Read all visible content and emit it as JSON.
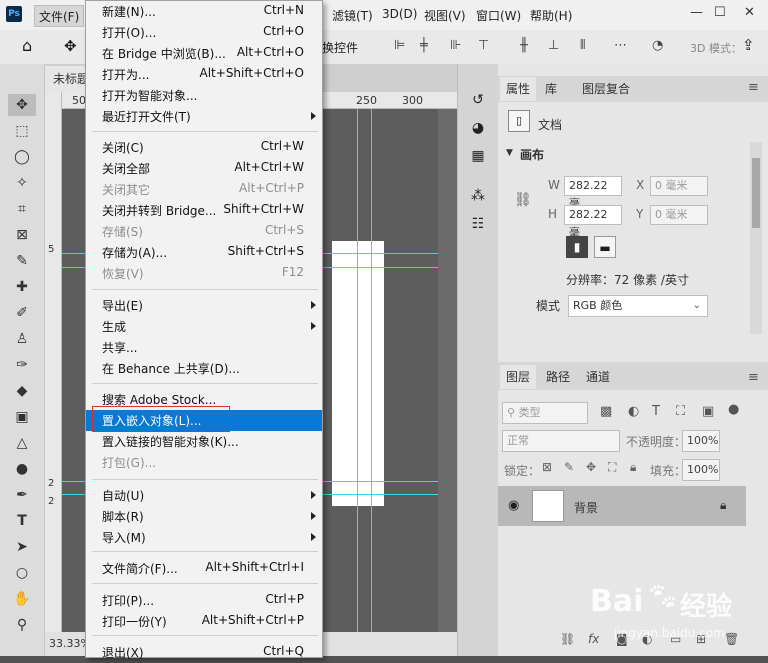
{
  "menubar": {
    "logo": "Ps",
    "items": [
      "文件(F)",
      "滤镜(T)",
      "3D(D)",
      "视图(V)",
      "窗口(W)",
      "帮助(H)"
    ],
    "window_buttons": [
      "—",
      "☐",
      "✕"
    ]
  },
  "options_bar": {
    "transform_controls_label": "换控件",
    "mode_3d_label": "3D 模式："
  },
  "document": {
    "tab_title": "未标题",
    "ruler_top_marks": [
      "50",
      "250",
      "300"
    ],
    "ruler_left_marks": [
      "5",
      "2",
      "2"
    ],
    "zoom": "33.33%"
  },
  "file_menu": {
    "items": [
      {
        "label": "新建(N)...",
        "shortcut": "Ctrl+N",
        "disabled": false
      },
      {
        "label": "打开(O)...",
        "shortcut": "Ctrl+O",
        "disabled": false
      },
      {
        "label": "在 Bridge 中浏览(B)...",
        "shortcut": "Alt+Ctrl+O",
        "disabled": false
      },
      {
        "label": "打开为...",
        "shortcut": "Alt+Shift+Ctrl+O",
        "disabled": false
      },
      {
        "label": "打开为智能对象...",
        "shortcut": "",
        "disabled": false
      },
      {
        "label": "最近打开文件(T)",
        "shortcut": "",
        "disabled": false,
        "submenu": true
      },
      {
        "label": "关闭(C)",
        "shortcut": "Ctrl+W",
        "disabled": false
      },
      {
        "label": "关闭全部",
        "shortcut": "Alt+Ctrl+W",
        "disabled": false
      },
      {
        "label": "关闭其它",
        "shortcut": "Alt+Ctrl+P",
        "disabled": true
      },
      {
        "label": "关闭并转到 Bridge...",
        "shortcut": "Shift+Ctrl+W",
        "disabled": false
      },
      {
        "label": "存储(S)",
        "shortcut": "Ctrl+S",
        "disabled": true
      },
      {
        "label": "存储为(A)...",
        "shortcut": "Shift+Ctrl+S",
        "disabled": false
      },
      {
        "label": "恢复(V)",
        "shortcut": "F12",
        "disabled": true
      },
      {
        "label": "导出(E)",
        "shortcut": "",
        "disabled": false,
        "submenu": true
      },
      {
        "label": "生成",
        "shortcut": "",
        "disabled": false,
        "submenu": true
      },
      {
        "label": "共享...",
        "shortcut": "",
        "disabled": false
      },
      {
        "label": "在 Behance 上共享(D)...",
        "shortcut": "",
        "disabled": false
      },
      {
        "label": "搜索 Adobe Stock...",
        "shortcut": "",
        "disabled": false
      },
      {
        "label": "置入嵌入对象(L)...",
        "shortcut": "",
        "disabled": false,
        "selected": true
      },
      {
        "label": "置入链接的智能对象(K)...",
        "shortcut": "",
        "disabled": false
      },
      {
        "label": "打包(G)...",
        "shortcut": "",
        "disabled": true
      },
      {
        "label": "自动(U)",
        "shortcut": "",
        "disabled": false,
        "submenu": true
      },
      {
        "label": "脚本(R)",
        "shortcut": "",
        "disabled": false,
        "submenu": true
      },
      {
        "label": "导入(M)",
        "shortcut": "",
        "disabled": false,
        "submenu": true
      },
      {
        "label": "文件简介(F)...",
        "shortcut": "Alt+Shift+Ctrl+I",
        "disabled": false
      },
      {
        "label": "打印(P)...",
        "shortcut": "Ctrl+P",
        "disabled": false
      },
      {
        "label": "打印一份(Y)",
        "shortcut": "Alt+Shift+Ctrl+P",
        "disabled": false
      },
      {
        "label": "退出(X)",
        "shortcut": "Ctrl+Q",
        "disabled": false
      }
    ]
  },
  "properties_panel": {
    "tabs": [
      "属性",
      "库",
      "图层复合"
    ],
    "doc_label": "文档",
    "section_title": "画布",
    "w_label": "W",
    "w_value": "282.22 毫",
    "h_label": "H",
    "h_value": "282.22 毫",
    "x_label": "X",
    "x_value": "0 毫米",
    "y_label": "Y",
    "y_value": "0 毫米",
    "resolution": "分辨率：72 像素 /英寸",
    "mode_label": "模式",
    "mode_value": "RGB 颜色"
  },
  "layers_panel": {
    "tabs": [
      "图层",
      "路径",
      "通道"
    ],
    "filter_placeholder": "类型",
    "blend_mode": "正常",
    "opacity_label": "不透明度：",
    "opacity_value": "100%",
    "lock_label": "锁定：",
    "fill_label": "填充：",
    "fill_value": "100%",
    "layer_name": "背景"
  },
  "watermark": {
    "brand": "Bai",
    "brand2": "经验",
    "url": "jingyan.baidu.com"
  }
}
